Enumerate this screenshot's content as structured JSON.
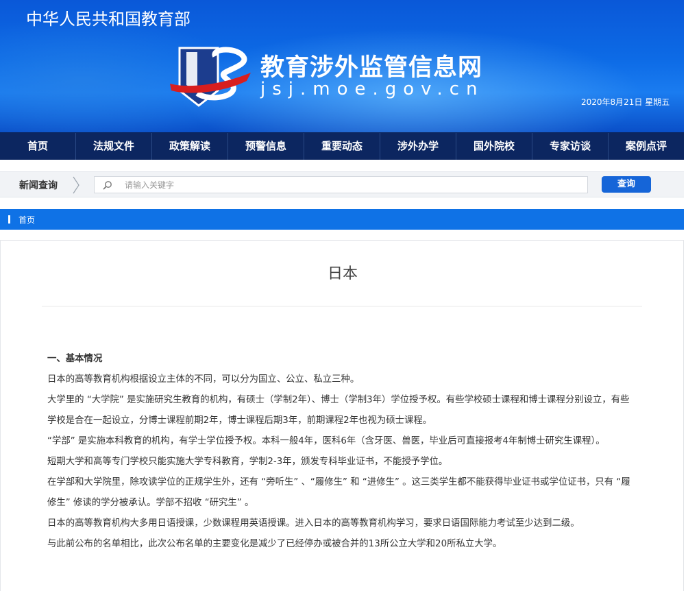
{
  "header": {
    "ministry": "中华人民共和国教育部",
    "site_name": "教育涉外监管信息网",
    "site_url": "jsj.moe.gov.cn",
    "date": "2020年8月21日  星期五"
  },
  "nav": {
    "items": [
      "首页",
      "法规文件",
      "政策解读",
      "预警信息",
      "重要动态",
      "涉外办学",
      "国外院校",
      "专家访谈",
      "案例点评"
    ]
  },
  "search": {
    "label": "新闻查询",
    "placeholder": "请输入关键字",
    "button": "查询"
  },
  "breadcrumb": {
    "home": "首页"
  },
  "article": {
    "title": "日本",
    "heading": "一、基本情况",
    "paragraphs": [
      "日本的高等教育机构根据设立主体的不同，可以分为国立、公立、私立三种。",
      "大学里的 “大学院” 是实施研究生教育的机构，有硕士（学制2年）、博士（学制3年）学位授予权。有些学校硕士课程和博士课程分别设立，有些学校是合在一起设立，分博士课程前期2年，博士课程后期3年，前期课程2年也视为硕士课程。",
      "“学部” 是实施本科教育的机构，有学士学位授予权。本科一般4年，医科6年（含牙医、兽医，毕业后可直接报考4年制博士研究生课程）。",
      "短期大学和高等专门学校只能实施大学专科教育，学制2-3年，颁发专科毕业证书，不能授予学位。",
      "在学部和大学院里，除攻读学位的正规学生外，还有 “旁听生” 、“履修生” 和 “进修生” 。这三类学生都不能获得毕业证书或学位证书，只有 “履修生” 修读的学分被承认。学部不招收 “研究生” 。",
      "日本的高等教育机构大多用日语授课，少数课程用英语授课。进入日本的高等教育机构学习，要求日语国际能力考试至少达到二级。",
      "与此前公布的名单相比，此次公布名单的主要变化是减少了已经停办或被合并的13所公立大学和20所私立大学。"
    ]
  }
}
